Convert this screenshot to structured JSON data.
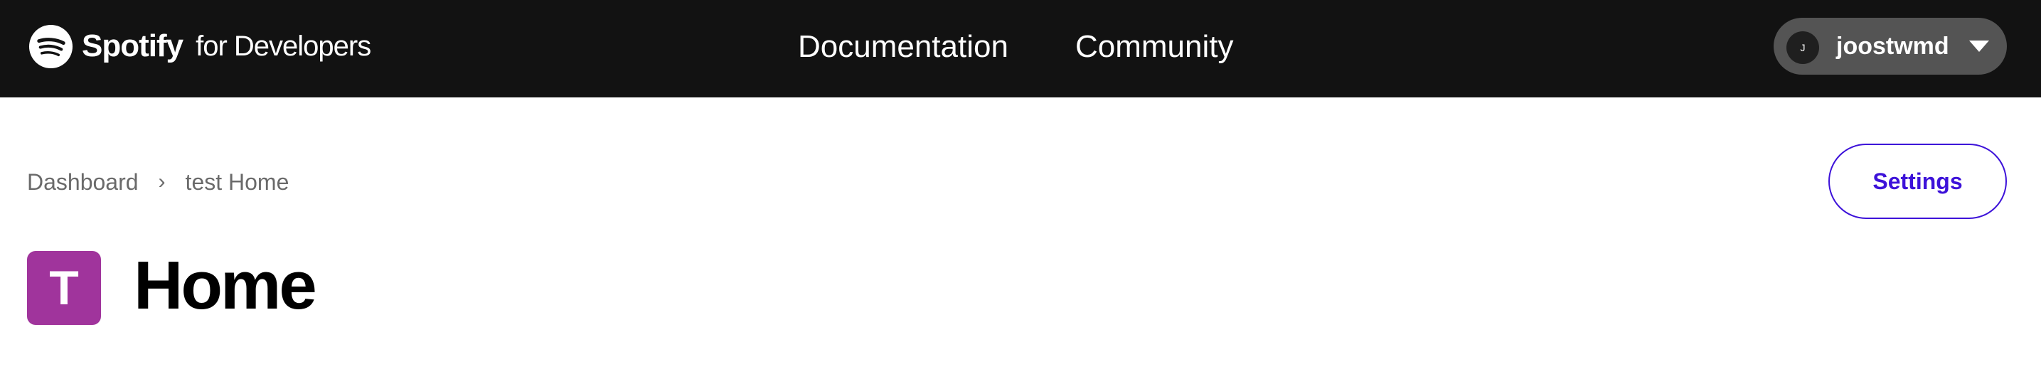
{
  "header": {
    "brand_name": "Spotify",
    "brand_sub": "for Developers",
    "nav": [
      {
        "label": "Documentation"
      },
      {
        "label": "Community"
      }
    ],
    "user": {
      "avatar_initial": "J",
      "username": "joostwmd"
    }
  },
  "breadcrumb": {
    "items": [
      "Dashboard",
      "test Home"
    ],
    "separator": "›"
  },
  "actions": {
    "settings_label": "Settings"
  },
  "app": {
    "icon_letter": "T",
    "title": "Home"
  },
  "colors": {
    "header_bg": "#121212",
    "accent": "#3d12d9",
    "app_icon_bg": "#a0349c",
    "user_pill_bg": "#545454"
  },
  "icons": {
    "brand": "spotify-logo-icon",
    "user_menu": "chevron-down-icon",
    "breadcrumb_separator": "chevron-right-icon"
  }
}
